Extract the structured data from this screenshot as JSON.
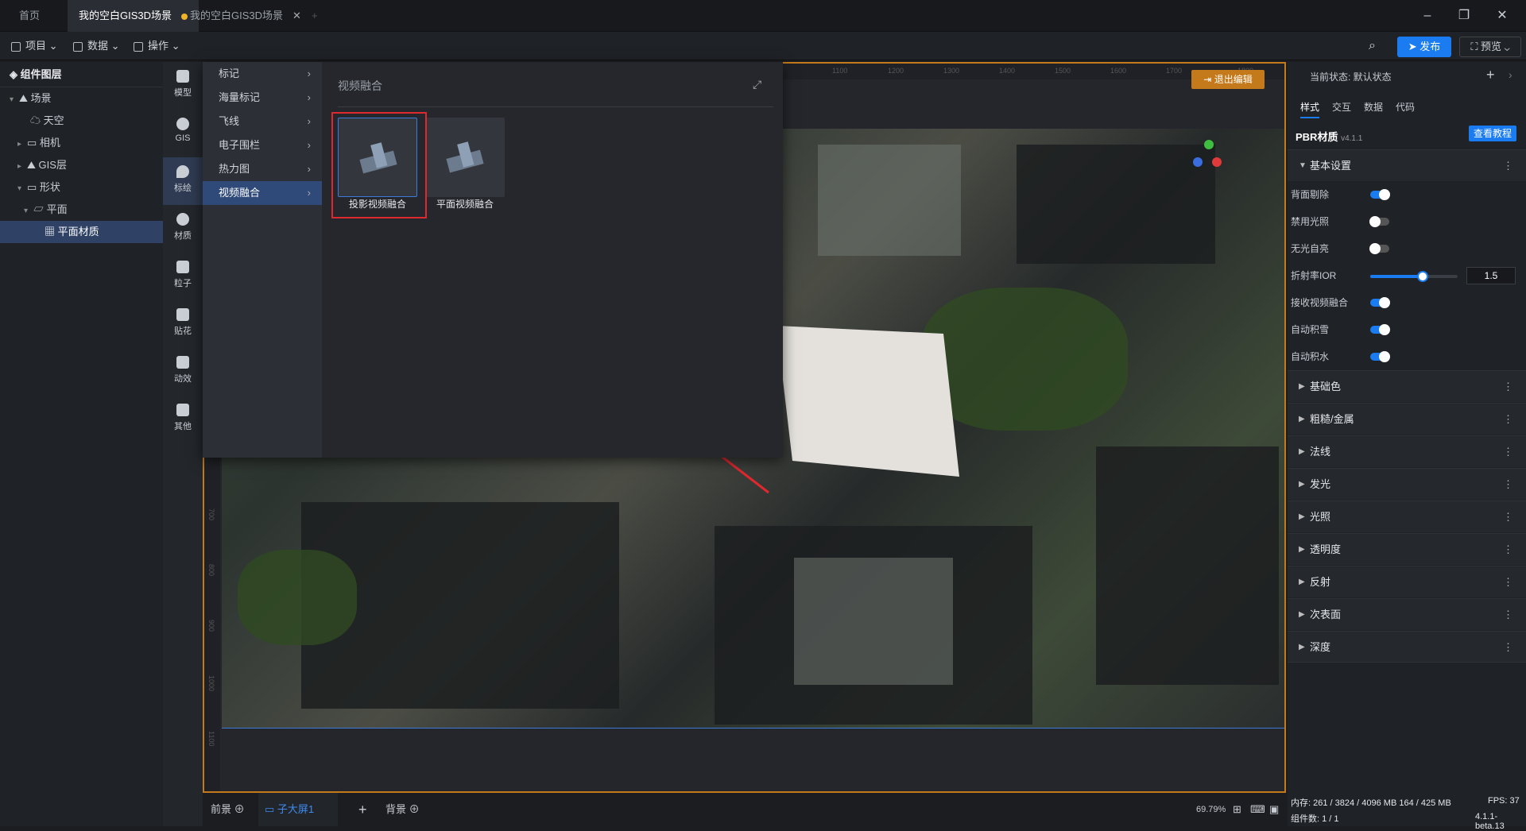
{
  "tabs": [
    "首页",
    "我的空白GIS3D场景",
    "我的空白GIS3D场景"
  ],
  "menubar": {
    "project": "项目",
    "data": "数据",
    "operate": "操作",
    "publish": "发布",
    "preview": "预览"
  },
  "layers": {
    "title": "组件图层",
    "items": [
      {
        "label": "场景",
        "indent": 0
      },
      {
        "label": "天空",
        "indent": 1
      },
      {
        "label": "相机",
        "indent": 1
      },
      {
        "label": "GIS层",
        "indent": 1
      },
      {
        "label": "形状",
        "indent": 1
      },
      {
        "label": "平面",
        "indent": 2
      },
      {
        "label": "平面材质",
        "indent": 3
      }
    ]
  },
  "tools": [
    "模型",
    "GIS",
    "标绘",
    "材质",
    "粒子",
    "贴花",
    "动效",
    "其他"
  ],
  "popup": {
    "categories": [
      "标记",
      "海量标记",
      "飞线",
      "电子围栏",
      "热力图",
      "视频融合"
    ],
    "title": "视频融合",
    "cards": [
      "投影视频融合",
      "平面视频融合"
    ]
  },
  "canvas": {
    "exit_edit": "退出编辑",
    "ruler_top": [
      "1100",
      "1200",
      "1300",
      "1400",
      "1500",
      "1600",
      "1700",
      "1800"
    ],
    "ruler_left": [
      "700",
      "800",
      "900",
      "1000",
      "1100"
    ]
  },
  "bottom": {
    "front": "前景",
    "screen": "子大屏1",
    "back": "背景",
    "zoom": "69.79%"
  },
  "right": {
    "state_label": "当前状态: 默认状态",
    "tabs": [
      "样式",
      "交互",
      "数据",
      "代码"
    ],
    "material": "PBR材质",
    "version": "v4.1.1",
    "tutorial": "查看教程",
    "basic": "基本设置",
    "rows": [
      {
        "label": "背面剔除",
        "on": true
      },
      {
        "label": "禁用光照",
        "on": false
      },
      {
        "label": "无光自亮",
        "on": false
      },
      {
        "label": "折射率IOR",
        "slider": 0.6,
        "value": "1.5"
      },
      {
        "label": "接收视频融合",
        "on": true
      },
      {
        "label": "自动积雪",
        "on": true
      },
      {
        "label": "自动积水",
        "on": true
      }
    ],
    "sections": [
      "基础色",
      "粗糙/金属",
      "法线",
      "发光",
      "光照",
      "透明度",
      "反射",
      "次表面",
      "深度"
    ]
  },
  "status": {
    "memory": "内存: 261 / 3824 / 4096 MB  164 / 425 MB",
    "fps": "FPS: 37",
    "components": "组件数: 1 / 1",
    "build": "4.1.1-beta.13"
  }
}
